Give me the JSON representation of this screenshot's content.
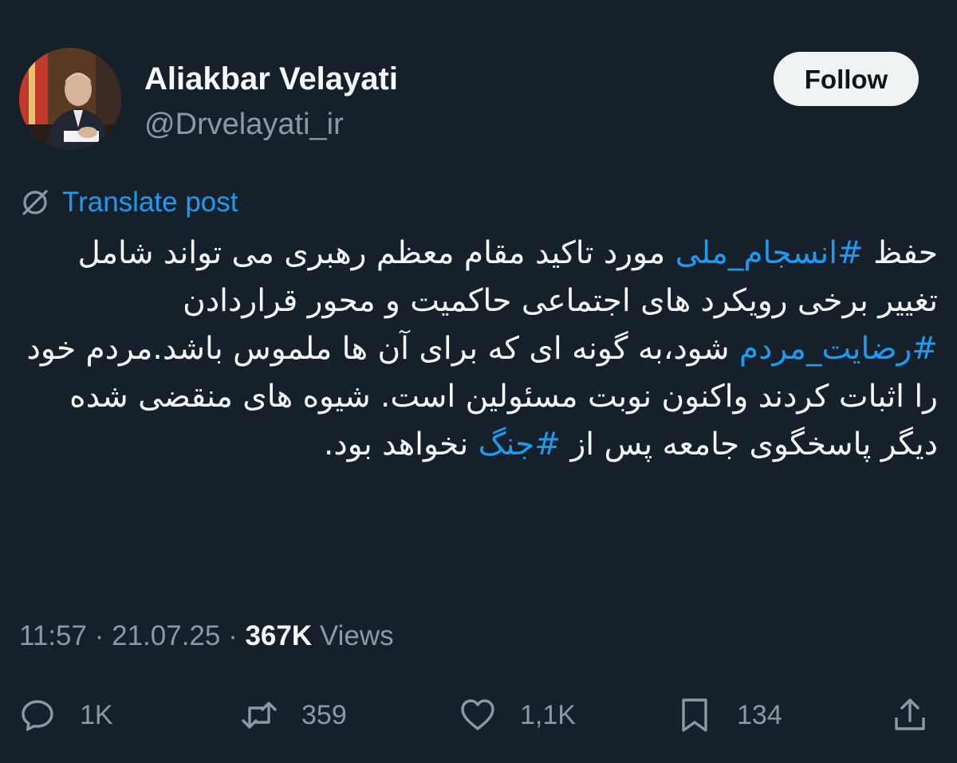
{
  "author": {
    "display_name": "Aliakbar Velayati",
    "handle": "@Drvelayati_ir"
  },
  "follow_label": "Follow",
  "translate_label": "Translate post",
  "post": {
    "seg1": "حفظ ",
    "tag1": "#انسجام_ملی",
    "seg2": " مورد تاکید مقام معظم رهبری می تواند شامل تغییر برخی رویکرد های اجتماعی حاکمیت و محور قراردادن ",
    "tag2": "#رضایت_مردم",
    "seg3": " شود،به گونه ای که برای آن ها ملموس باشد.مردم خود را اثبات کردند واکنون نوبت مسئولین است. شیوه های منقضی شده دیگر پاسخگوی جامعه پس از ",
    "tag3": "#جنگ",
    "seg4": " نخواهد بود."
  },
  "meta": {
    "time": "11:57",
    "separator": " · ",
    "date": "21.07.25",
    "views_count": "367K",
    "views_label": " Views"
  },
  "actions": {
    "replies": "1K",
    "reposts": "359",
    "likes": "1,1K",
    "bookmarks": "134"
  },
  "colors": {
    "background": "#15202b",
    "text": "#f7f9f9",
    "secondary": "#8b98a5",
    "accent": "#1d9bf0",
    "follow_bg": "#eff3f4"
  },
  "icons": [
    "translate-icon",
    "reply-icon",
    "repost-icon",
    "like-icon",
    "bookmark-icon",
    "share-icon"
  ]
}
